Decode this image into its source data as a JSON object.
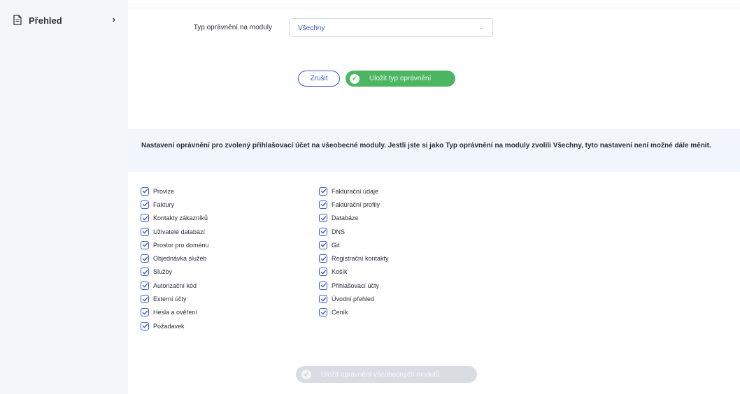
{
  "sidebar": {
    "items": [
      {
        "label": "Přehled",
        "icon": "document-icon"
      }
    ]
  },
  "form": {
    "module_permission_label": "Typ oprávnění na moduly",
    "module_permission_value": "Všechny"
  },
  "actions": {
    "cancel_label": "Zrušit",
    "save_type_label": "Uložit typ oprávnění"
  },
  "info": {
    "text": "Nastavení oprávnění pro zvolený přihlašovací účet na všeobecné moduly. Jestli jste si jako Typ oprávnění na moduly zvolili Všechny, tyto nastavení není možné dále měnit."
  },
  "permissions": {
    "left": [
      {
        "label": "Provize",
        "checked": true
      },
      {
        "label": "Faktury",
        "checked": true
      },
      {
        "label": "Kontakty zákazníků",
        "checked": true
      },
      {
        "label": "Uživatelé databází",
        "checked": true
      },
      {
        "label": "Prostor pro doménu",
        "checked": true
      },
      {
        "label": "Objednávka služeb",
        "checked": true
      },
      {
        "label": "Služby",
        "checked": true
      },
      {
        "label": "Autorizační kód",
        "checked": true
      },
      {
        "label": "Externí účty",
        "checked": true
      },
      {
        "label": "Hesla a ověření",
        "checked": true
      },
      {
        "label": "Požadavek",
        "checked": true
      }
    ],
    "right": [
      {
        "label": "Fakturační údaje",
        "checked": true
      },
      {
        "label": "Fakturační profily",
        "checked": true
      },
      {
        "label": "Databáze",
        "checked": true
      },
      {
        "label": "DNS",
        "checked": true
      },
      {
        "label": "Git",
        "checked": true
      },
      {
        "label": "Registrační kontakty",
        "checked": true
      },
      {
        "label": "Košík",
        "checked": true
      },
      {
        "label": "Přihlašovací účty",
        "checked": true
      },
      {
        "label": "Úvodní přehled",
        "checked": true
      },
      {
        "label": "Ceník",
        "checked": true
      }
    ]
  },
  "footer": {
    "save_modules_label": "Uložit oprávnění všeobecných modulů",
    "disabled": true
  },
  "colors": {
    "accent": "#3b5bc4",
    "success": "#4cb662",
    "disabled": "#d9dde3",
    "info_bg": "#f1f6fc"
  }
}
